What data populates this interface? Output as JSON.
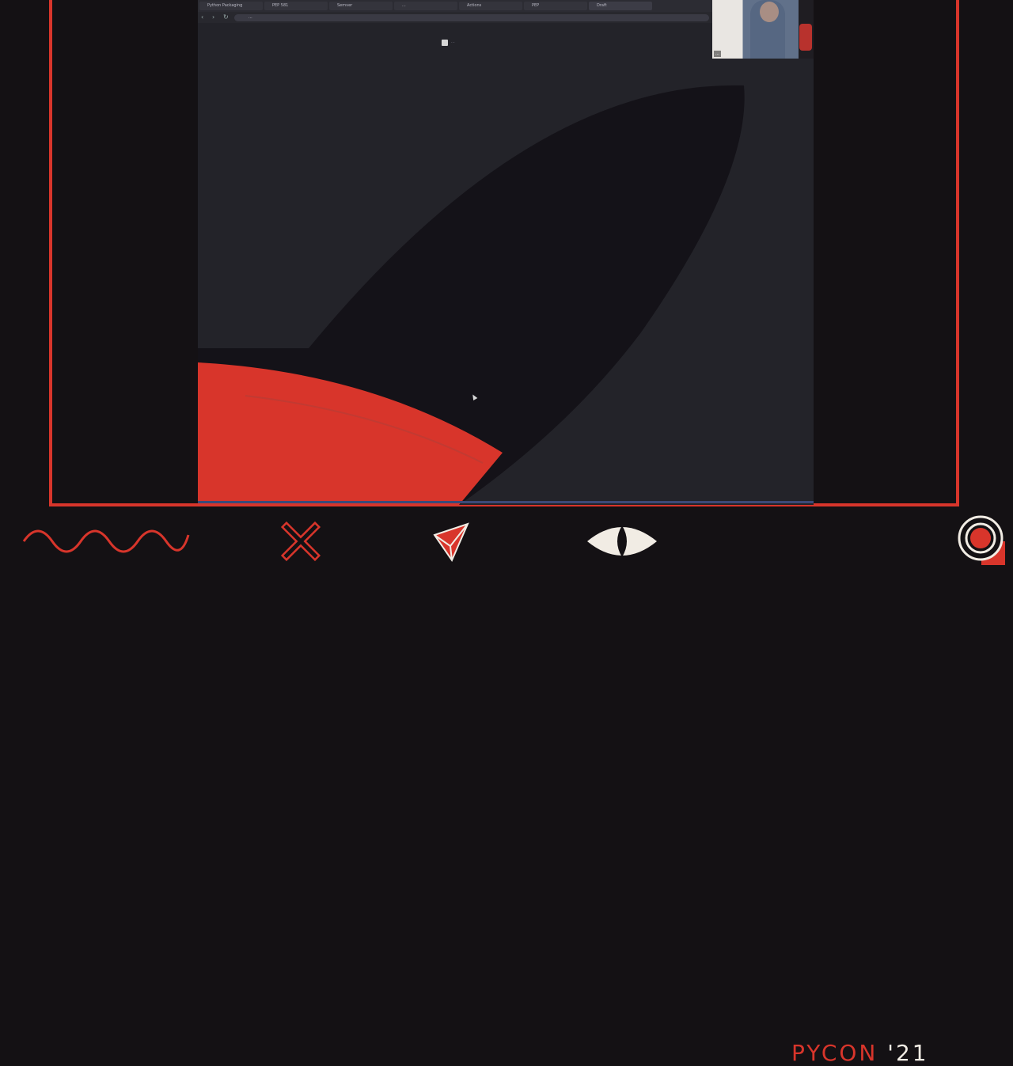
{
  "colors": {
    "accent": "#d8352b",
    "background": "#141114",
    "screen": "#232329",
    "cream": "#f1ece4",
    "shadow": "#141218"
  },
  "browser": {
    "tabs": [
      {
        "label": "Python Packaging"
      },
      {
        "label": "PEP 581"
      },
      {
        "label": "Semver"
      },
      {
        "label": "..."
      },
      {
        "label": "Actions"
      },
      {
        "label": "PEP"
      },
      {
        "label": "Draft"
      }
    ],
    "address": "...",
    "widget_label": "..."
  },
  "webcam": {
    "name_label": "..."
  },
  "footer": {
    "brand_word": "PYCON",
    "brand_year": "'21",
    "icons": [
      "wave-icon",
      "x-icon",
      "triangle-icon",
      "eye-icon",
      "target-icon"
    ]
  }
}
